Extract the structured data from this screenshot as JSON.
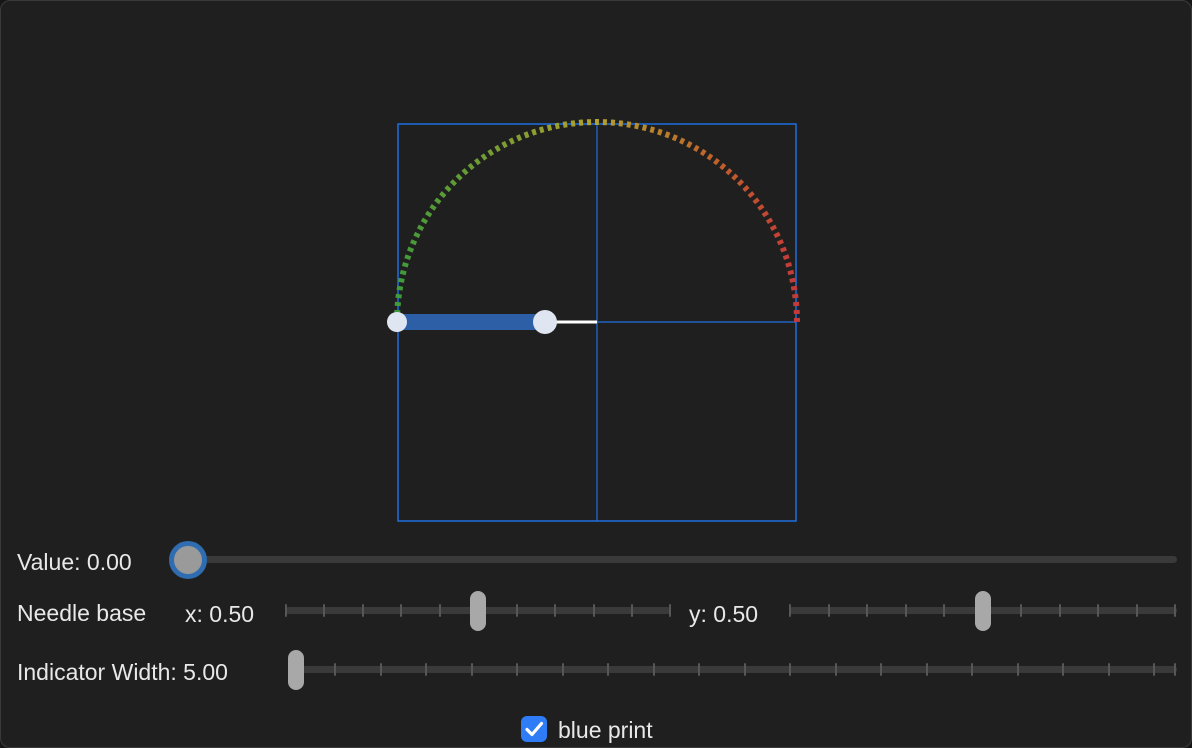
{
  "value_slider": {
    "label": "Value: 0.00",
    "value": 0.0
  },
  "needle_base": {
    "label": "Needle base",
    "x_label": "x: 0.50",
    "x_value": 0.5,
    "y_label": "y: 0.50",
    "y_value": 0.5
  },
  "indicator_width": {
    "label": "Indicator Width: 5.00",
    "value": 5.0
  },
  "blue_print": {
    "label": "blue print",
    "checked": true
  },
  "colors": {
    "accent": "#2e7cf6",
    "blueprint_line": "#1f6fe0",
    "arc_start": "#3f9a3a",
    "arc_mid": "#b2a12c",
    "arc_end": "#c23a3a",
    "indicator": "#2d5fa6"
  }
}
